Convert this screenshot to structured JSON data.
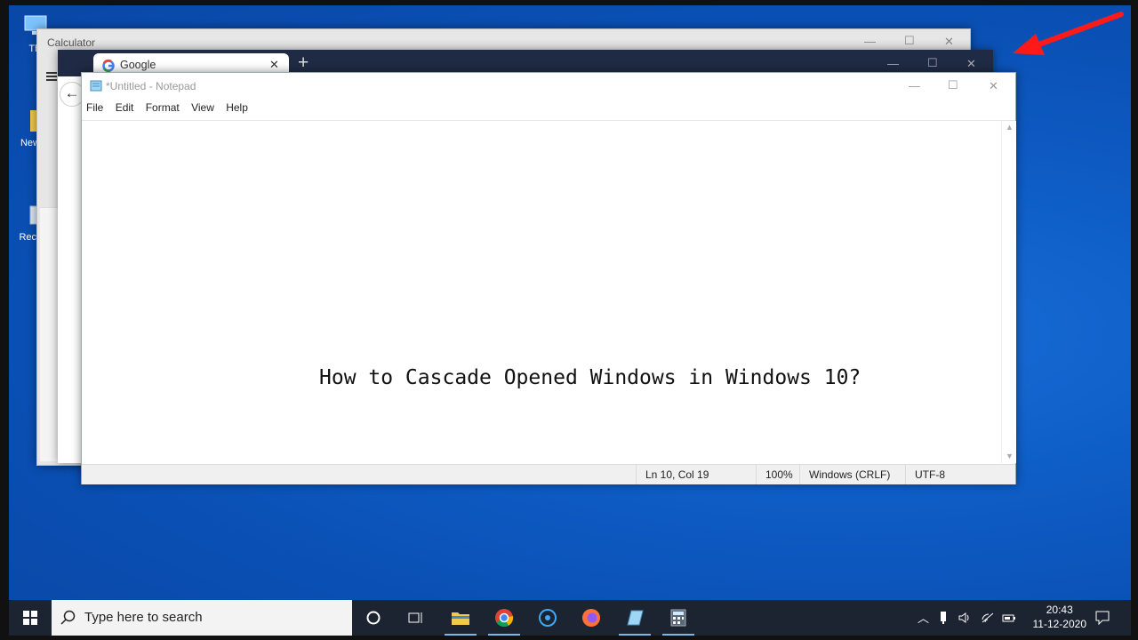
{
  "desktop": {
    "icons": [
      {
        "label": "Thi"
      },
      {
        "label": "New"
      },
      {
        "label": "Recy"
      }
    ]
  },
  "calculator": {
    "title": "Calculator",
    "controls": {
      "minimize": "—",
      "maximize": "☐",
      "close": "✕"
    }
  },
  "chrome": {
    "tab_label": "Google",
    "new_tab": "+",
    "tab_close": "✕",
    "controls": {
      "minimize": "—",
      "maximize": "☐",
      "close": "✕"
    }
  },
  "notepad": {
    "title": "*Untitled - Notepad",
    "menu": [
      "File",
      "Edit",
      "Format",
      "View",
      "Help"
    ],
    "content": "How to Cascade Opened Windows in Windows 10?",
    "status": {
      "position": "Ln 10, Col 19",
      "zoom": "100%",
      "line_endings": "Windows (CRLF)",
      "encoding": "UTF-8"
    },
    "controls": {
      "minimize": "—",
      "maximize": "☐",
      "close": "✕"
    }
  },
  "taskbar": {
    "search_placeholder": "Type here to search",
    "time": "20:43",
    "date": "11-12-2020"
  },
  "colors": {
    "desktop": "#0e5dc6",
    "taskbar": "#1c2431",
    "arrow": "#ff1a1a",
    "chrome_frame": "#1f2a44"
  }
}
